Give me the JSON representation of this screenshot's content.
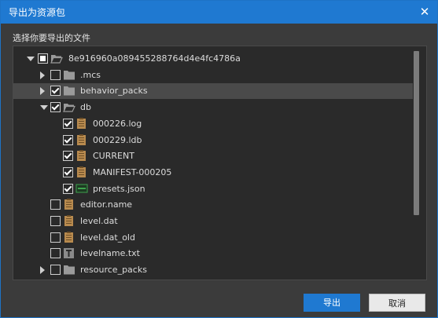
{
  "dialog": {
    "title": "导出为资源包",
    "close_glyph": "✕",
    "prompt": "选择你要导出的文件"
  },
  "tree": [
    {
      "label": "8e916960a089455288764d4e4fc4786a",
      "depth": 0,
      "expand": "down",
      "check": "partial",
      "icon": "folder-open-icon"
    },
    {
      "label": ".mcs",
      "depth": 1,
      "expand": "right",
      "check": "unchecked",
      "icon": "folder-icon"
    },
    {
      "label": "behavior_packs",
      "depth": 1,
      "expand": "right",
      "check": "checked",
      "icon": "folder-icon",
      "selected": true
    },
    {
      "label": "db",
      "depth": 1,
      "expand": "down",
      "check": "checked",
      "icon": "folder-open-icon"
    },
    {
      "label": "000226.log",
      "depth": 2,
      "expand": "none",
      "check": "checked",
      "icon": "file-icon"
    },
    {
      "label": "000229.ldb",
      "depth": 2,
      "expand": "none",
      "check": "checked",
      "icon": "file-icon"
    },
    {
      "label": "CURRENT",
      "depth": 2,
      "expand": "none",
      "check": "checked",
      "icon": "file-icon"
    },
    {
      "label": "MANIFEST-000205",
      "depth": 2,
      "expand": "none",
      "check": "checked",
      "icon": "file-icon"
    },
    {
      "label": "presets.json",
      "depth": 2,
      "expand": "none",
      "check": "checked",
      "icon": "json-file-icon"
    },
    {
      "label": "editor.name",
      "depth": 1,
      "expand": "none",
      "check": "unchecked",
      "icon": "file-icon"
    },
    {
      "label": "level.dat",
      "depth": 1,
      "expand": "none",
      "check": "unchecked",
      "icon": "file-icon"
    },
    {
      "label": "level.dat_old",
      "depth": 1,
      "expand": "none",
      "check": "unchecked",
      "icon": "file-icon"
    },
    {
      "label": "levelname.txt",
      "depth": 1,
      "expand": "none",
      "check": "unchecked",
      "icon": "text-file-icon"
    },
    {
      "label": "resource_packs",
      "depth": 1,
      "expand": "right",
      "check": "unchecked",
      "icon": "folder-icon"
    }
  ],
  "buttons": {
    "export": "导出",
    "cancel": "取消"
  },
  "colors": {
    "accent": "#1f79d1",
    "folder": "#9a9a9a",
    "file": "#b88a4e",
    "json": "#3fa34d"
  }
}
